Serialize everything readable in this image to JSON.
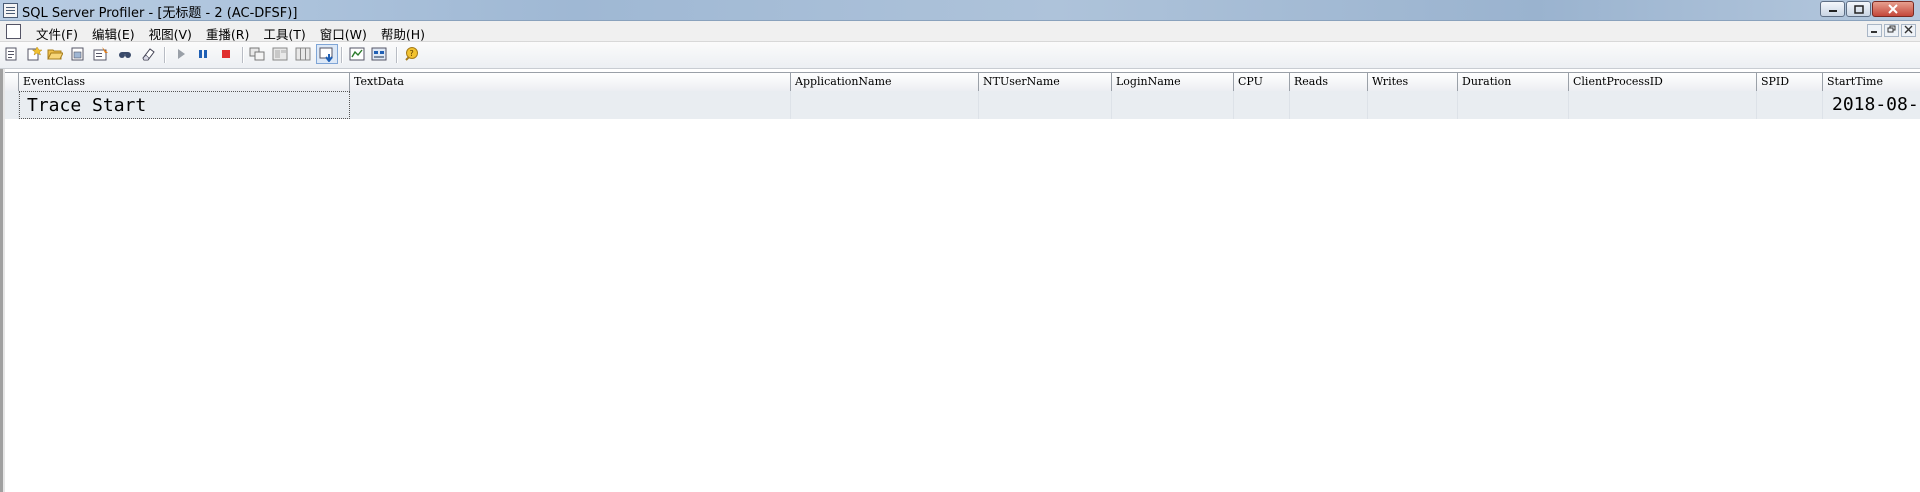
{
  "window": {
    "title": "SQL Server Profiler - [无标题 - 2 (AC-DFSF)]",
    "controls": {
      "minimize": "0",
      "maximize": "1",
      "close": "r"
    }
  },
  "menubar": {
    "items": [
      "文件(F)",
      "编辑(E)",
      "视图(V)",
      "重播(R)",
      "工具(T)",
      "窗口(W)",
      "帮助(H)"
    ],
    "mdi_controls": {
      "minimize": "_",
      "restore": "❐",
      "close": "x"
    }
  },
  "toolbar": {
    "buttons": [
      "new-trace-icon",
      "new-template-icon",
      "open-icon",
      "save-icon",
      "properties-icon",
      "find-icon",
      "clear-trace-icon",
      "run-trace-icon",
      "pause-trace-icon",
      "stop-trace-icon",
      "properties-window-icon",
      "templates-icon",
      "columns-icon",
      "auto-scroll-icon",
      "performance-chart-icon",
      "trace-log-icon",
      "help-icon"
    ],
    "accent": "#1f5fb4"
  },
  "grid": {
    "columns": [
      "EventClass",
      "TextData",
      "ApplicationName",
      "NTUserName",
      "LoginName",
      "CPU",
      "Reads",
      "Writes",
      "Duration",
      "ClientProcessID",
      "SPID",
      "StartTime"
    ],
    "rows": [
      {
        "EventClass": "Trace Start",
        "StartTime": "2018-08-"
      }
    ]
  }
}
